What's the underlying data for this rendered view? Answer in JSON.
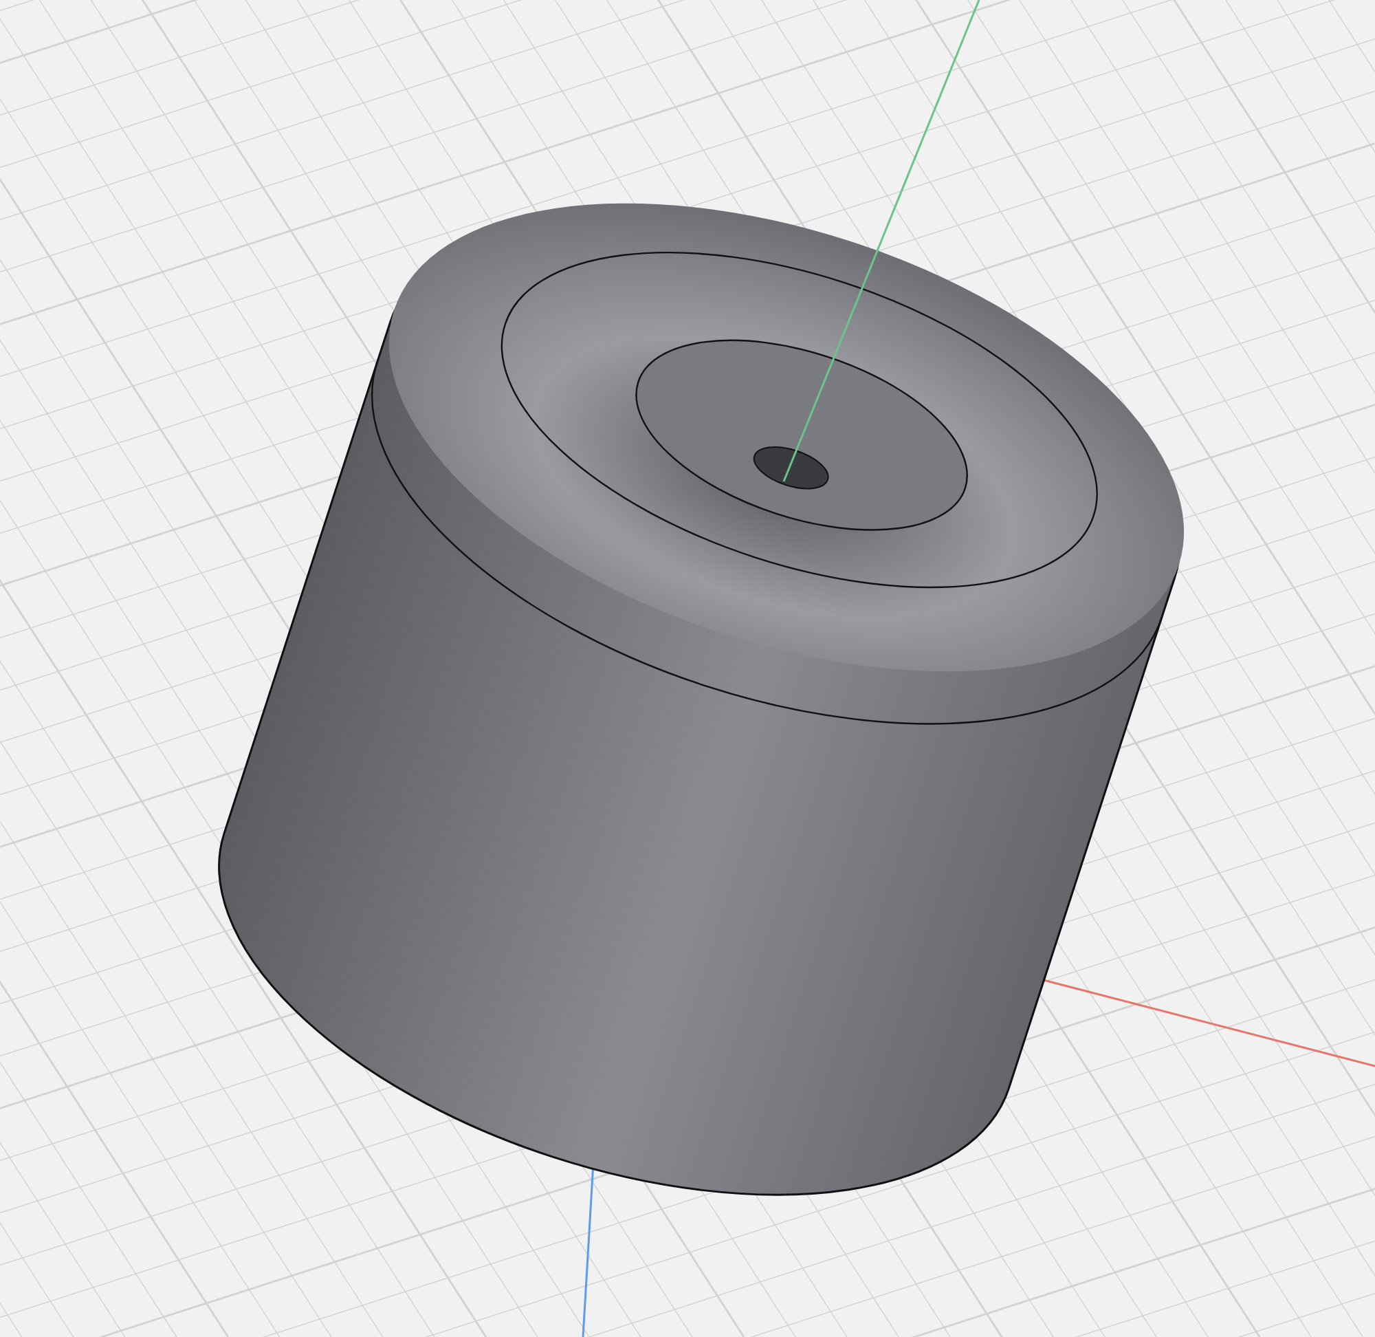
{
  "viewport": {
    "grid": true,
    "axes": [
      {
        "kind": "x",
        "color": "#e8756a"
      },
      {
        "kind": "y",
        "color": "#6cc48a"
      },
      {
        "kind": "z",
        "color": "#5b9cf0"
      }
    ]
  }
}
